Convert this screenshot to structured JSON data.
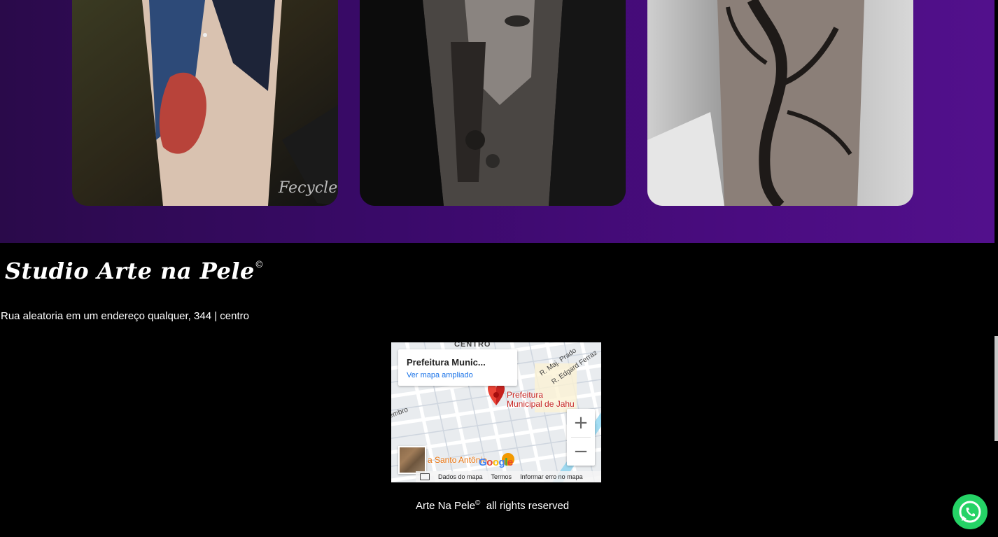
{
  "gallery": {
    "cards": [
      {
        "name": "tattoo-photo-1",
        "description_icon": "tattoo-image"
      },
      {
        "name": "tattoo-photo-2",
        "description_icon": "tattoo-image"
      },
      {
        "name": "tattoo-photo-3",
        "description_icon": "tattoo-image"
      }
    ]
  },
  "footer": {
    "studio_name": "Studio Arte na Pele",
    "studio_mark": "©",
    "address": "Rua aleatoria em um endereço qualquer, 344 | centro",
    "copyright_brand": "Arte Na Pele",
    "copyright_mark": "©",
    "copyright_text": "all rights reserved"
  },
  "map": {
    "place_title": "Prefeitura Munic...",
    "enlarge_link": "Ver mapa ampliado",
    "pin_label_line1": "Prefeitura",
    "pin_label_line2": "Municipal de Jahu",
    "poi_label": "a Santo Antônio",
    "street_labels": [
      "R. Maj. Prado",
      "R. Edgard Ferraz",
      "CENTRO",
      "embro"
    ],
    "zoom_in": "+",
    "zoom_out": "−",
    "map_data_link": "Dados do mapa",
    "terms_link": "Termos",
    "report_link": "Informar erro no mapa",
    "logo_text": "Google"
  },
  "colors": {
    "gallery_gradient_start": "#2a0a4a",
    "gallery_gradient_end": "#52108c",
    "footer_bg": "#000000",
    "whatsapp_green": "#25d366",
    "map_pin_red": "#ea4335"
  },
  "whatsapp": {
    "icon": "whatsapp-icon"
  }
}
